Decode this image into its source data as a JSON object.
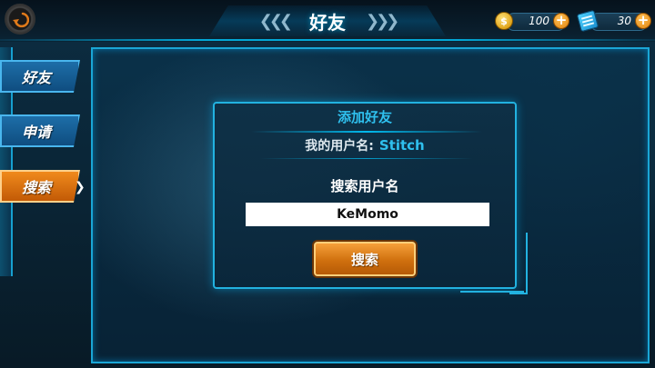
{
  "header": {
    "title": "好友"
  },
  "currency": {
    "coins": "100",
    "cards": "30"
  },
  "sidebar": {
    "tabs": [
      {
        "label": "好友",
        "active": false
      },
      {
        "label": "申请",
        "active": false
      },
      {
        "label": "搜索",
        "active": true
      }
    ]
  },
  "dialog": {
    "title": "添加好友",
    "my_name_label": "我的用户名:",
    "my_name_value": "Stitch",
    "search_label": "搜索用户名",
    "search_value": "KeMomo",
    "search_button": "搜索"
  },
  "colors": {
    "accent_cyan": "#2fc0ee",
    "active_tab_orange": "#f08a1c",
    "tab_blue": "#1d6ea8",
    "button_orange": "#d0700e"
  },
  "icons": [
    "back-icon",
    "coin-icon",
    "card-icon",
    "plus-icon",
    "chevron-right-icon"
  ]
}
